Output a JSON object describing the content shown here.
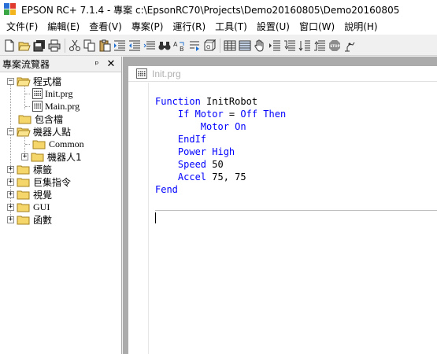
{
  "window": {
    "title": "EPSON RC+ 7.1.4 - 專案 c:\\EpsonRC70\\Projects\\Demo20160805\\Demo20160805"
  },
  "menu": [
    {
      "label": "文件(F)"
    },
    {
      "label": "編輯(E)"
    },
    {
      "label": "查看(V)"
    },
    {
      "label": "專案(P)"
    },
    {
      "label": "運行(R)"
    },
    {
      "label": "工具(T)"
    },
    {
      "label": "設置(U)"
    },
    {
      "label": "窗口(W)"
    },
    {
      "label": "說明(H)"
    }
  ],
  "toolbar_icons": [
    "new-file-icon",
    "open-folder-icon",
    "save-all-icon",
    "print-icon",
    "cut-icon",
    "copy-icon",
    "paste-icon",
    "indent-icon",
    "outdent-icon",
    "unindent-icon",
    "find-icon",
    "replace-icon",
    "goto-icon",
    "cube-icon",
    "build-icon",
    "table-icon",
    "hand-icon",
    "step-icon",
    "step-into-icon",
    "step-over-icon",
    "step-out-icon",
    "stop-icon",
    "robot-icon"
  ],
  "explorer": {
    "title": "專案流覽器",
    "pin_label": "ᵖ",
    "close_label": "✕",
    "tree": {
      "program_files": {
        "label": "程式檔",
        "children": [
          {
            "label": "Init.prg"
          },
          {
            "label": "Main.prg"
          }
        ]
      },
      "include_files": {
        "label": "包含檔"
      },
      "robot_points": {
        "label": "機器人點",
        "children": [
          {
            "label": "Common"
          },
          {
            "label": "機器人1"
          }
        ]
      },
      "labels": {
        "label": "標籤"
      },
      "macros": {
        "label": "巨集指令"
      },
      "vision": {
        "label": "視覺"
      },
      "gui": {
        "label": "GUI"
      },
      "functions": {
        "label": "函數"
      }
    }
  },
  "editor": {
    "tab_title": "Init.prg",
    "code_lines": [
      [
        {
          "t": "Function",
          "k": true
        },
        {
          "t": " InitRobot",
          "k": false
        }
      ],
      [
        {
          "t": "    If Motor",
          "k": true
        },
        {
          "t": " = ",
          "k": false
        },
        {
          "t": "Off Then",
          "k": true
        }
      ],
      [
        {
          "t": "        Motor On",
          "k": true
        }
      ],
      [
        {
          "t": "    EndIf",
          "k": true
        }
      ],
      [
        {
          "t": "    Power High",
          "k": true
        }
      ],
      [
        {
          "t": "    Speed",
          "k": true
        },
        {
          "t": " 50",
          "k": false
        }
      ],
      [
        {
          "t": "    Accel",
          "k": true
        },
        {
          "t": " 75, 75",
          "k": false
        }
      ],
      [
        {
          "t": "Fend",
          "k": true
        }
      ]
    ]
  },
  "colors": {
    "keyword": "#0000ff",
    "editor_background": "#ababab",
    "folder_yellow": "#f5d66b"
  }
}
